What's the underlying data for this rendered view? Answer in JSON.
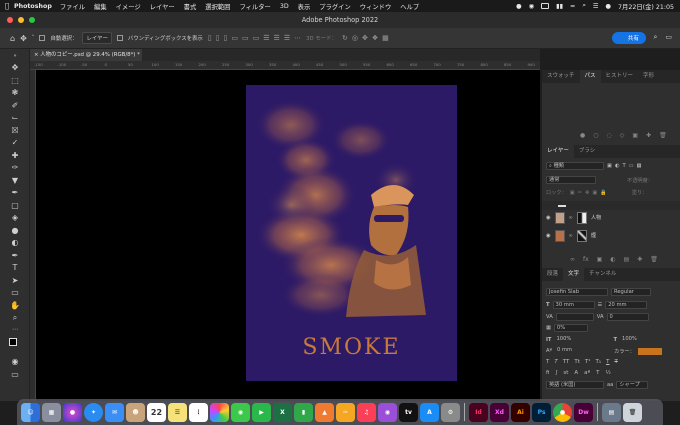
{
  "menubar": {
    "app_name": "Photoshop",
    "items": [
      "ファイル",
      "編集",
      "イメージ",
      "レイヤー",
      "書式",
      "選択範囲",
      "フィルター",
      "3D",
      "表示",
      "プラグイン",
      "ウィンドウ",
      "ヘルプ"
    ],
    "clock": "7月22日(金) 21:05"
  },
  "window": {
    "title": "Adobe Photoshop 2022"
  },
  "options": {
    "auto_select_label": "自動選択：",
    "auto_select_target": "レイヤー",
    "bounding_box_label": "バウンディングボックスを表示",
    "mode_3d_label": "3D モード：",
    "share_label": "共有"
  },
  "document": {
    "tab_label": "人物のコピー.psd @ 29.4% (RGB/8*) *"
  },
  "ruler": {
    "ticks": [
      "-150",
      "-100",
      "-50",
      "0",
      "50",
      "100",
      "150",
      "200",
      "250",
      "300",
      "350",
      "400",
      "450",
      "500",
      "550",
      "600",
      "650",
      "700",
      "750",
      "800",
      "850",
      "900"
    ]
  },
  "poster": {
    "title": "SMOKE"
  },
  "panels": {
    "top_tabs": [
      "スウォッチ",
      "パス",
      "ヒストリー",
      "字形"
    ],
    "top_active": 1,
    "layer_tabs": [
      "レイヤー",
      "ブラシ"
    ],
    "layer_kind": "種類",
    "blend_mode": "通常",
    "opacity_label": "不透明度：",
    "lock_label": "ロック：",
    "fill_label": "塗り：",
    "layers": [
      {
        "name": "人物"
      },
      {
        "name": "煙"
      }
    ],
    "type_tabs": [
      "段落",
      "文字",
      "チャンネル"
    ],
    "font_family": "Josefin Slab",
    "font_style": "Regular",
    "font_size": "30 mm",
    "leading": "20 mm",
    "kerning": "",
    "tracking": "0",
    "baseline_scale": "0%",
    "vscale": "100%",
    "hscale": "100%",
    "baseline_shift": "0 mm",
    "color_label": "カラー：",
    "text_color": "#c8741e",
    "language": "英語 (米国)",
    "aa_label": "aa",
    "aa_value": "シャープ"
  },
  "dock": {
    "apps": [
      "Finder",
      "Launchpad",
      "Siri",
      "Safari",
      "Mail",
      "Contacts",
      "Calendar",
      "Notes",
      "Reminders",
      "Photos",
      "Messages",
      "FaceTime",
      "Excel",
      "Numbers",
      "Keynote",
      "Pages",
      "Music",
      "Podcasts",
      "TV",
      "App Store",
      "System Preferences",
      "Id",
      "Xd",
      "Ai",
      "Ps",
      "Chrome",
      "Dw",
      "Folder",
      "Trash"
    ],
    "calendar_day": "22",
    "labels": {
      "id": "Id",
      "xd": "Xd",
      "ai": "Ai",
      "ps": "Ps",
      "dw": "Dw",
      "tv": "tv"
    }
  }
}
